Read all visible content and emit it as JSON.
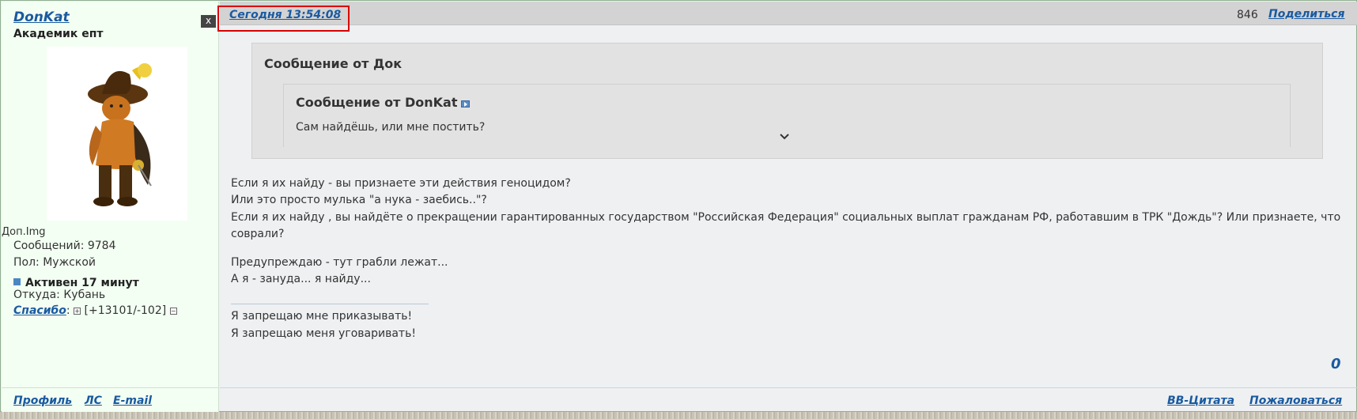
{
  "user": {
    "name": "DonKat",
    "title": "Академик епт",
    "close_label": "x",
    "img_label": "Доп.Img",
    "posts": "Сообщений: 9784",
    "gender": "Пол: Мужской",
    "status": "Активен 17 минут",
    "location": "Откуда: Кубань",
    "thanks_label": "Спасибо",
    "thanks_colon": ":",
    "thanks_plus": "+",
    "thanks_value": "[+13101/-102]",
    "thanks_minus": "−",
    "links": {
      "profile": "Профиль",
      "pm": "ЛС",
      "email": "E-mail"
    }
  },
  "post": {
    "date": "Сегодня 13:54:08",
    "number": "846",
    "share": "Поделиться",
    "quote": {
      "title": "Сообщение от Док",
      "inner_title": "Сообщение от DonKat",
      "inner_text": "Сам найдёшь, или мне постить?"
    },
    "body": [
      "Если я их найду - вы признаете эти действия геноцидом?",
      "Или это просто  мулька \"а нука - заебись..\"?",
      "Если я их найду , вы найдёте о прекращении гарантированных государством \"Российская Федерация\" социальных выплат гражданам РФ, работавшим в ТРК \"Дождь\"?  Или признаете, что",
      "соврали?",
      "Предупреждаю - тут грабли лежат...",
      "А я - зануда... я найду..."
    ],
    "signature": [
      "Я запрещаю мне приказывать!",
      "Я запрещаю меня уговаривать!"
    ],
    "counter": "0",
    "footer": {
      "bbquote": "BB-Цитата",
      "report": "Пожаловаться"
    }
  },
  "colors": {
    "link": "#1a5aa0",
    "highlight": "#d90000",
    "sidebar_bg": "#f3fff3",
    "status": "#4b86c2"
  },
  "icons": [
    "close-icon",
    "goto-post-icon",
    "chevron-down-icon",
    "thanks-plus-icon",
    "thanks-minus-icon"
  ]
}
